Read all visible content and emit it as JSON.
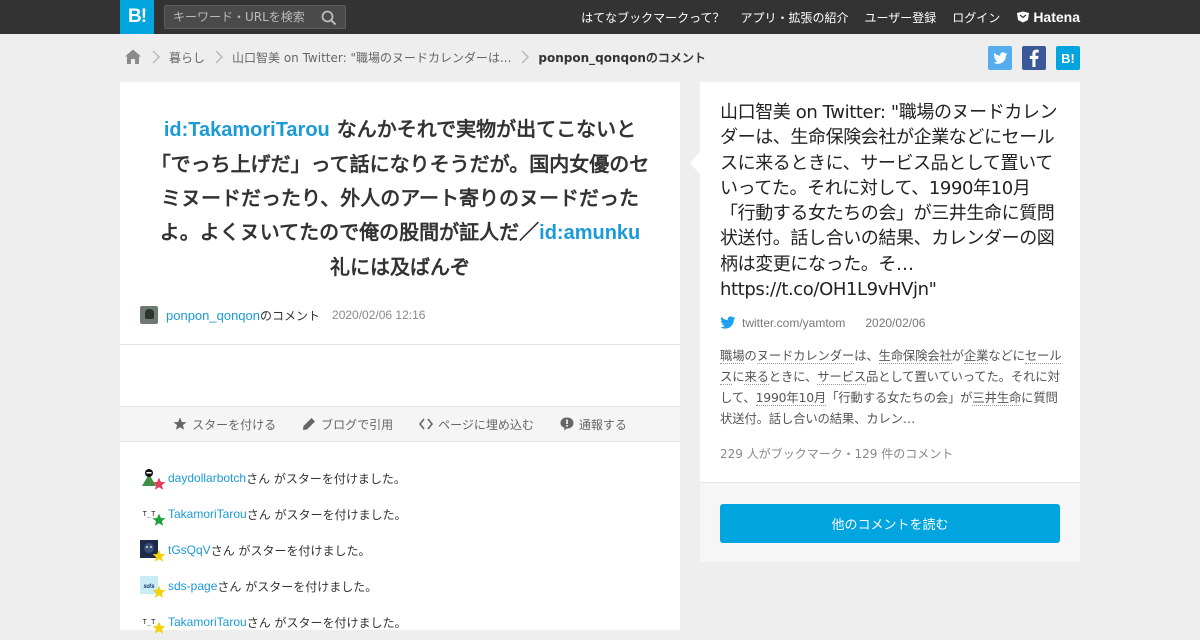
{
  "header": {
    "logo": "B!",
    "search_placeholder": "キーワード・URLを検索",
    "nav": [
      "はてなブックマークって？",
      "アプリ・拡張の紹介",
      "ユーザー登録",
      "ログイン"
    ],
    "brand": "Hatena"
  },
  "breadcrumb": {
    "category": "暮らし",
    "entry": "山口智美 on Twitter: \"職場のヌードカレンダーは...",
    "current": "ponpon_qonqonのコメント"
  },
  "share": {
    "hatena_label": "B!"
  },
  "comment": {
    "mention1": "id:TakamoriTarou",
    "text1": " なんかそれで実物が出てこないと「でっち上げだ」って話になりそうだが。国内女優のセミヌードだったり、外人のアート寄りのヌードだったよ。よくヌいてたので俺の股間が証人だ／",
    "mention2": "id:amunku",
    "text2": " 礼には及ばんぞ",
    "user": "ponpon_qonqon",
    "user_suffix": "のコメント",
    "date": "2020/02/06 12:16"
  },
  "actions": [
    "スターを付ける",
    "ブログで引用",
    "ページに埋め込む",
    "通報する"
  ],
  "stars": [
    {
      "user": "daydollarbotch",
      "text": "さん がスターを付けました。",
      "star_color": "#e0405e",
      "avatar_bg": "#3f8f46",
      "avatar_text": ""
    },
    {
      "user": "TakamoriTarou",
      "text": "さん がスターを付けました。",
      "star_color": "#1aa33b",
      "avatar_bg": "#ffffff",
      "avatar_text": "T_T"
    },
    {
      "user": "tGsQqV",
      "text": "さん がスターを付けました。",
      "star_color": "#f3d20a",
      "avatar_bg": "#1d2a4c",
      "avatar_text": ""
    },
    {
      "user": "sds-page",
      "text": "さん がスターを付けました。",
      "star_color": "#f3d20a",
      "avatar_bg": "#c9ecf7",
      "avatar_text": "sds"
    },
    {
      "user": "TakamoriTarou",
      "text": "さん がスターを付けました。",
      "star_color": "#f3d20a",
      "avatar_bg": "#ffffff",
      "avatar_text": "T_T"
    }
  ],
  "entry": {
    "title": "山口智美 on Twitter: \"職場のヌードカレンダーは、生命保険会社が企業などにセールスに来るときに、サービス品として置いていってた。それに対して、1990年10月「行動する女たちの会」が三井生命に質問状送付。話し合いの結果、カレンダーの図柄は変更になった。そ… https://t.co/OH1L9vHVjn\"",
    "source": "twitter.com/yamtom",
    "date": "2020/02/06",
    "excerpt_parts": [
      {
        "t": "職場",
        "u": true
      },
      {
        "t": "の",
        "u": false
      },
      {
        "t": "ヌードカレンダー",
        "u": true
      },
      {
        "t": "は、",
        "u": false
      },
      {
        "t": "生命保険会社",
        "u": true
      },
      {
        "t": "が",
        "u": false
      },
      {
        "t": "企業",
        "u": true
      },
      {
        "t": "などに",
        "u": false
      },
      {
        "t": "セールス",
        "u": true
      },
      {
        "t": "に",
        "u": false
      },
      {
        "t": "来る",
        "u": true
      },
      {
        "t": "ときに、",
        "u": false
      },
      {
        "t": "サービス",
        "u": true
      },
      {
        "t": "品として置いていってた。それに対して、",
        "u": false
      },
      {
        "t": "1990年10月",
        "u": true
      },
      {
        "t": "「行動する女たちの会」が",
        "u": false
      },
      {
        "t": "三井生命",
        "u": true
      },
      {
        "t": "に質問状送付。話し合いの結果、カレン…",
        "u": false
      }
    ],
    "counts": "229 人がブックマーク・129 件のコメント"
  },
  "read_more": "他のコメントを読む"
}
